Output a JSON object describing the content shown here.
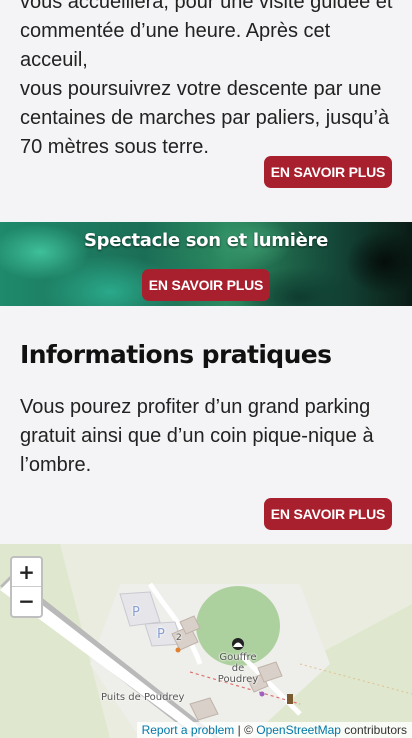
{
  "intro": {
    "lines": [
      "vous accueillera, pour une visite guidée et",
      "commentée d’une heure. Après cet acceuil,",
      "vous poursuivrez votre descente par une",
      "centaines de marches par paliers, jusqu’à",
      "70 mètres sous terre."
    ],
    "button_label": "EN SAVOIR PLUS"
  },
  "banner": {
    "title": "Spectacle son et lumière",
    "button_label": "EN SAVOIR PLUS"
  },
  "info": {
    "heading": "Informations pratiques",
    "lines": [
      "Vous pourez profiter d’un grand parking",
      "gratuit ainsi que d’un coin pique-nique à",
      "l’ombre."
    ],
    "button_label": "EN SAVOIR PLUS"
  },
  "map": {
    "zoom_in": "+",
    "zoom_out": "−",
    "labels": {
      "gouffre_line1": "Gouffre",
      "gouffre_line2": "de Poudrey",
      "puits": "Puits de Poudrey",
      "parking": "P",
      "number": "2"
    },
    "attribution": {
      "report": "Report a problem",
      "separator": " | © ",
      "osm": "OpenStreetMap",
      "contributors": " contributors"
    }
  },
  "colors": {
    "button": "#a8202e",
    "background": "#f4f3f5",
    "map_land": "#dfe8cf",
    "map_forest": "#add19e"
  }
}
